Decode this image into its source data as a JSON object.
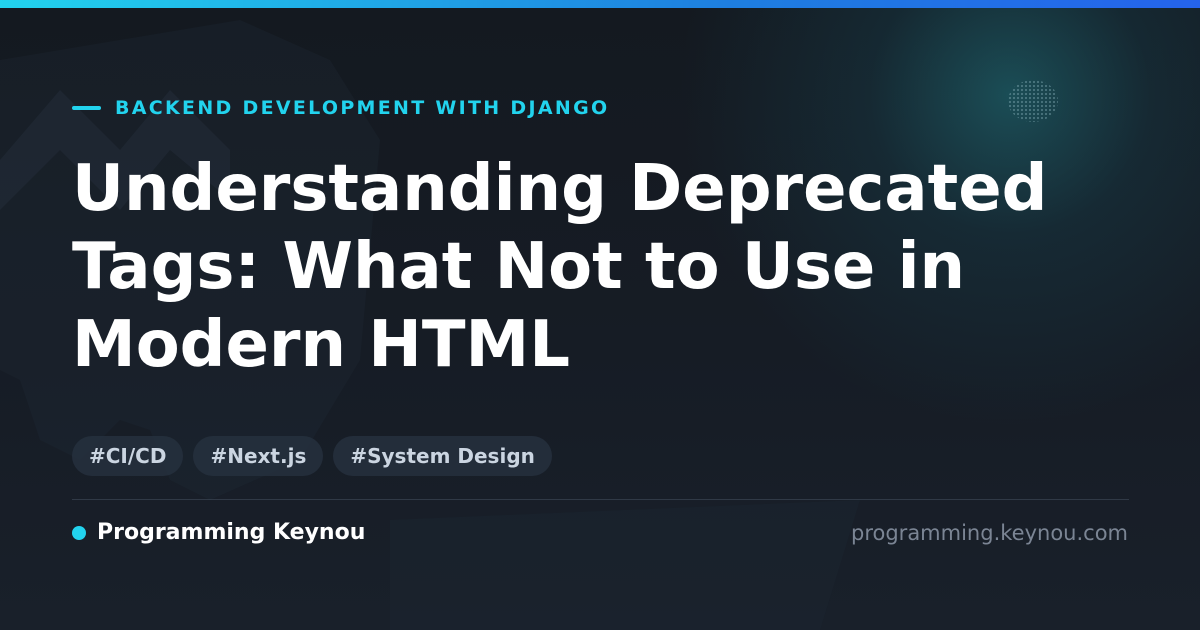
{
  "colors": {
    "accent": "#22d3ee",
    "accent_end": "#2563eb",
    "background": "#131820",
    "title": "#ffffff",
    "tag_text": "#cbd5e1",
    "url_text": "#7b8594"
  },
  "eyebrow": {
    "label": "BACKEND DEVELOPMENT WITH DJANGO"
  },
  "title": "Understanding Deprecated Tags: What Not to Use in Modern HTML",
  "tags": [
    {
      "label": "#CI/CD"
    },
    {
      "label": "#Next.js"
    },
    {
      "label": "#System Design"
    }
  ],
  "footer": {
    "brand": "Programming Keynou",
    "url": "programming.keynou.com"
  },
  "icons": {
    "brand_marker": "filled-circle-dot",
    "eyebrow_marker": "horizontal-dash"
  }
}
